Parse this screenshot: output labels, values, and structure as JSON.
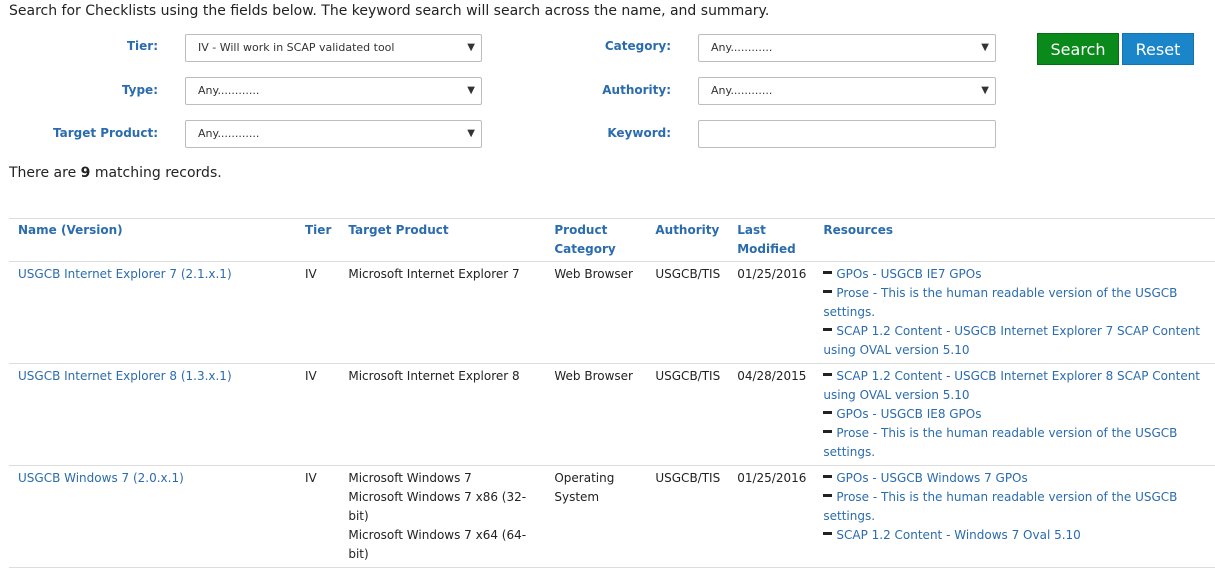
{
  "intro": "Search for Checklists using the fields below. The keyword search will search across the name, and summary.",
  "filters": {
    "tier": {
      "label": "Tier:",
      "value": "IV - Will work in SCAP validated tool"
    },
    "type": {
      "label": "Type:",
      "value": "Any............"
    },
    "target_product": {
      "label": "Target Product:",
      "value": "Any............"
    },
    "category": {
      "label": "Category:",
      "value": "Any............"
    },
    "authority": {
      "label": "Authority:",
      "value": "Any............"
    },
    "keyword": {
      "label": "Keyword:",
      "value": ""
    }
  },
  "buttons": {
    "search": "Search",
    "reset": "Reset"
  },
  "results": {
    "prefix": "There are ",
    "count": "9",
    "suffix": " matching records."
  },
  "table": {
    "headers": [
      "Name (Version)",
      "Tier",
      "Target Product",
      "Product Category",
      "Authority",
      "Last Modified",
      "Resources"
    ],
    "rows": [
      {
        "name": "USGCB Internet Explorer 7 (2.1.x.1)",
        "tier": "IV",
        "products": [
          "Microsoft Internet Explorer 7"
        ],
        "category": "Web Browser",
        "authority": "USGCB/TIS",
        "modified": "01/25/2016",
        "resources": [
          "GPOs - USGCB IE7 GPOs",
          "Prose - This is the human readable version of the USGCB settings.",
          "SCAP 1.2 Content - USGCB Internet Explorer 7 SCAP Content using OVAL version 5.10"
        ]
      },
      {
        "name": "USGCB Internet Explorer 8 (1.3.x.1)",
        "tier": "IV",
        "products": [
          "Microsoft Internet Explorer 8"
        ],
        "category": "Web Browser",
        "authority": "USGCB/TIS",
        "modified": "04/28/2015",
        "resources": [
          "SCAP 1.2 Content - USGCB Internet Explorer 8 SCAP Content using OVAL version 5.10",
          "GPOs - USGCB IE8 GPOs",
          "Prose - This is the human readable version of the USGCB settings."
        ]
      },
      {
        "name": "USGCB Windows 7 (2.0.x.1)",
        "tier": "IV",
        "products": [
          "Microsoft Windows 7",
          "Microsoft Windows 7 x86 (32-bit)",
          "Microsoft Windows 7 x64 (64-bit)"
        ],
        "category": "Operating System",
        "authority": "USGCB/TIS",
        "modified": "01/25/2016",
        "resources": [
          "GPOs - USGCB Windows 7 GPOs",
          "Prose - This is the human readable version of the USGCB settings.",
          "SCAP 1.2 Content - Windows 7 Oval 5.10"
        ]
      }
    ]
  }
}
